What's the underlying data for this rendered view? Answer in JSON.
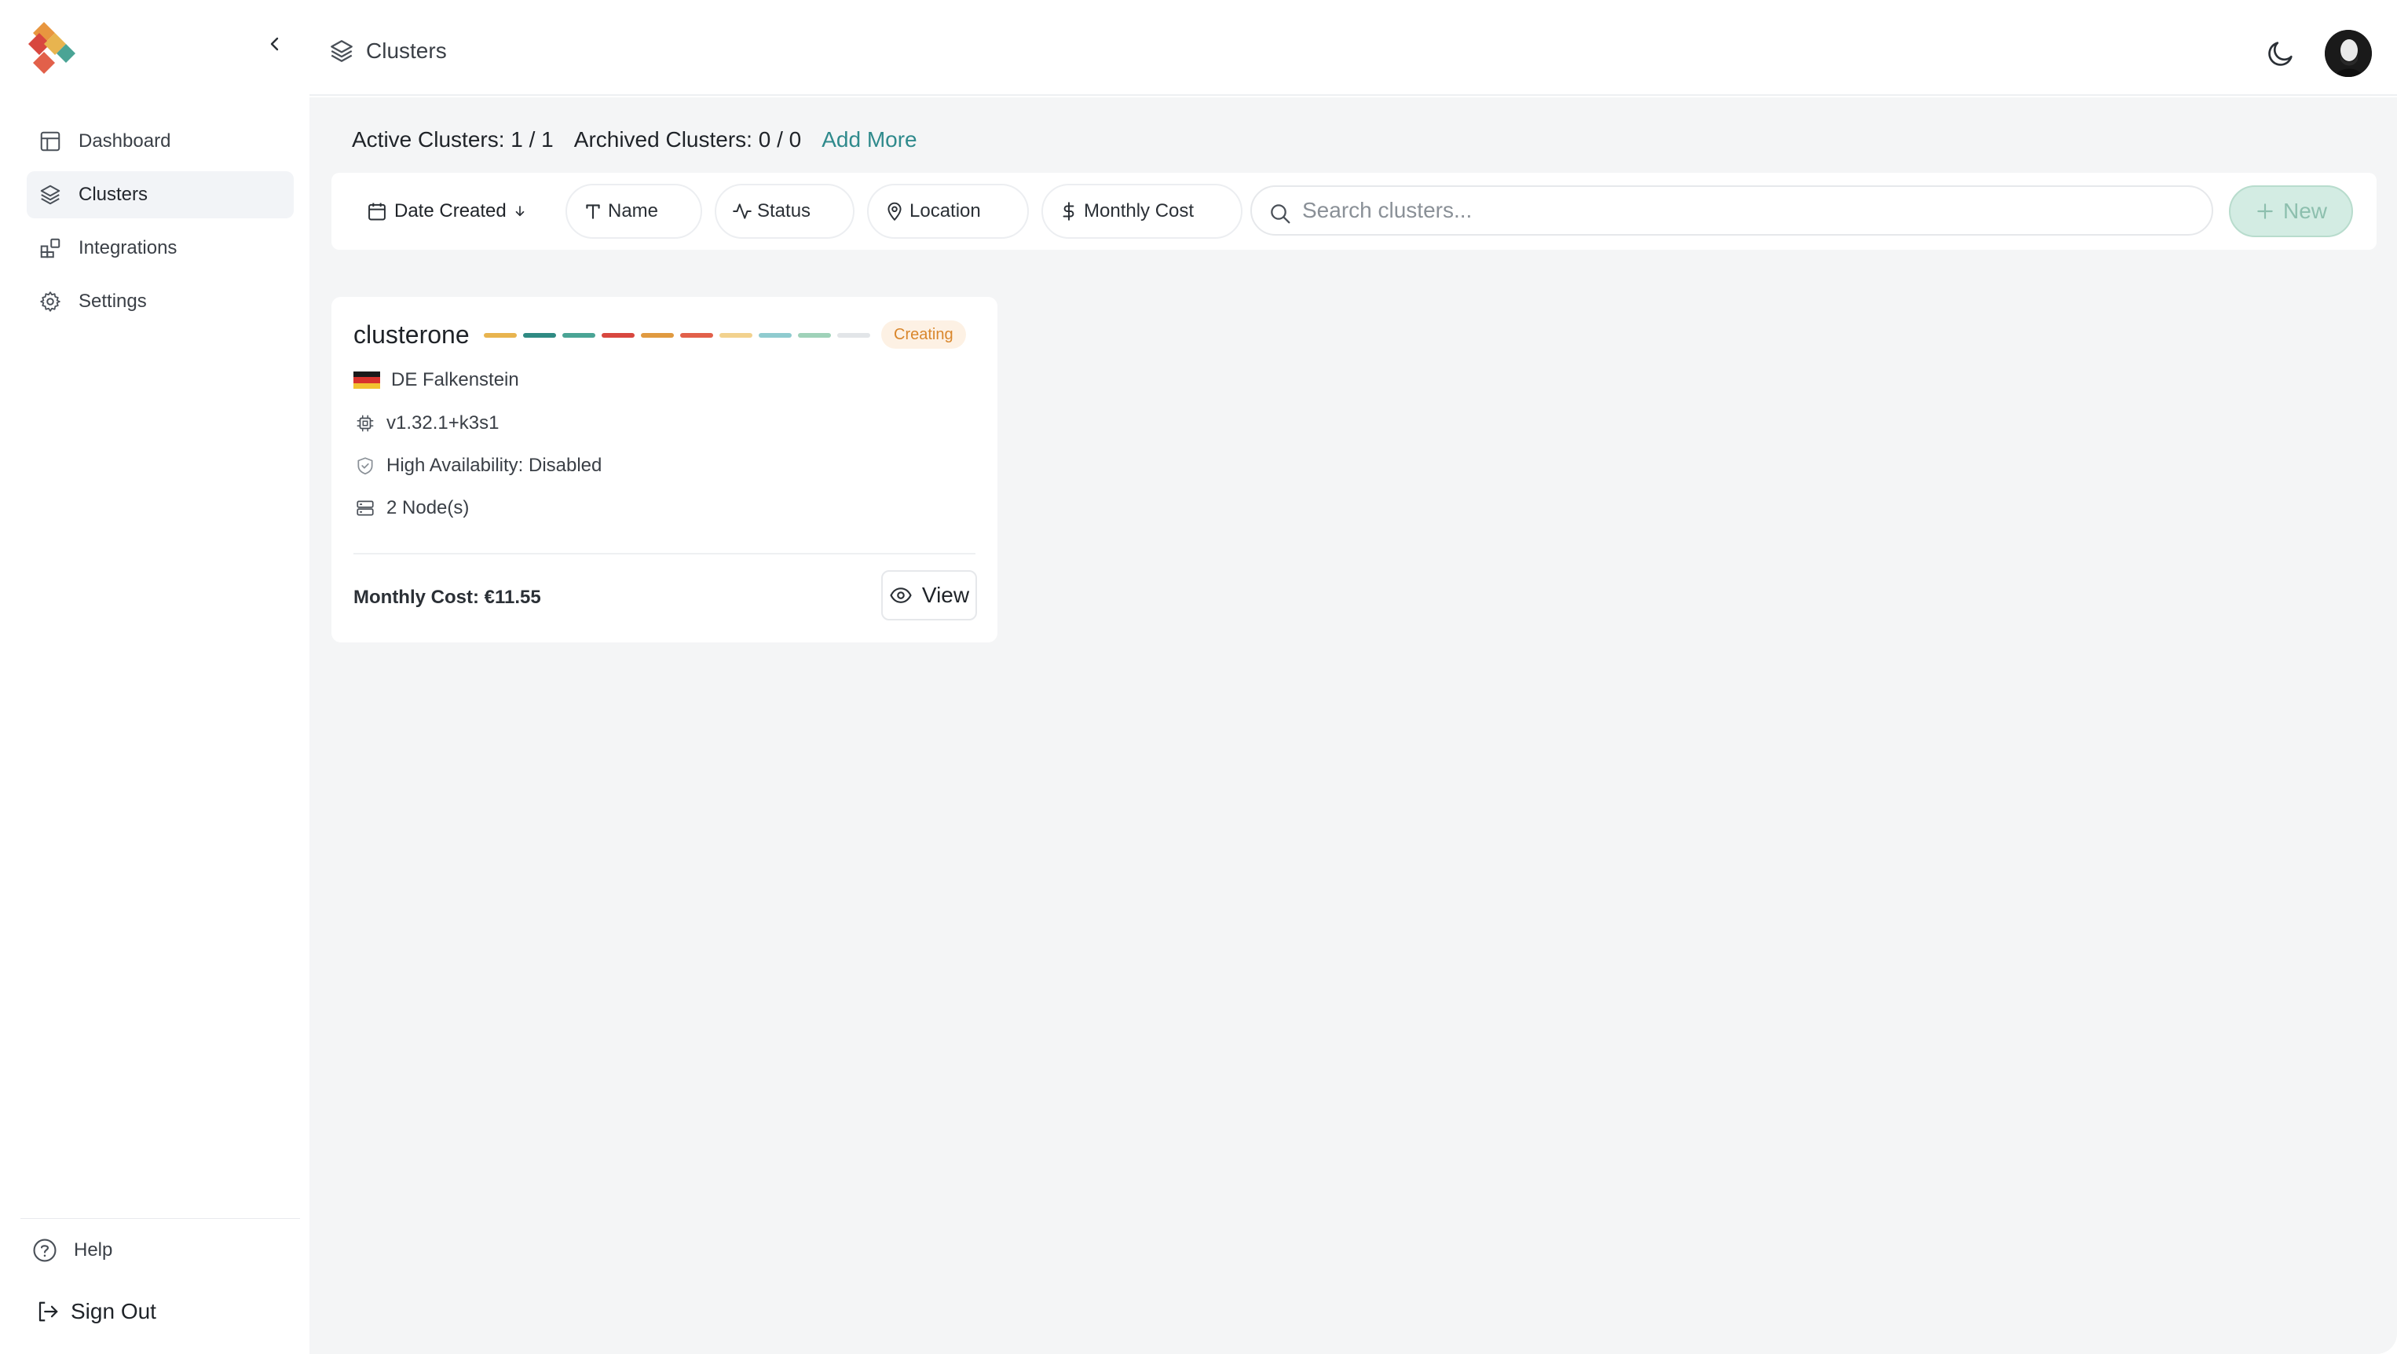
{
  "sidebar": {
    "items": [
      {
        "label": "Dashboard",
        "icon": "layout-icon"
      },
      {
        "label": "Clusters",
        "icon": "layers-icon",
        "active": true
      },
      {
        "label": "Integrations",
        "icon": "blocks-icon"
      },
      {
        "label": "Settings",
        "icon": "gear-icon"
      }
    ],
    "help_label": "Help",
    "signout_label": "Sign Out"
  },
  "header": {
    "breadcrumb": "Clusters"
  },
  "stats": {
    "active": "Active Clusters: 1 / 1",
    "archived": "Archived Clusters: 0 / 0",
    "add_more": "Add More"
  },
  "filters": {
    "sort_label": "Date Created",
    "chips": [
      "Name",
      "Status",
      "Location",
      "Monthly Cost"
    ],
    "search_placeholder": "Search clusters...",
    "new_label": "New"
  },
  "cluster": {
    "name": "clusterone",
    "status": "Creating",
    "segment_colors": [
      "#e8b44f",
      "#2f8a83",
      "#4aa495",
      "#d8473f",
      "#e09a40",
      "#e2604a",
      "#f2d28e",
      "#8fcbcf",
      "#9fd2b9",
      "#e2e5e8"
    ],
    "location": "DE Falkenstein",
    "version": "v1.32.1+k3s1",
    "ha": "High Availability: Disabled",
    "nodes": "2 Node(s)",
    "monthly_cost": "Monthly Cost: €11.55",
    "view_label": "View"
  },
  "colors": {
    "accent": "#2f8a8c",
    "status_creating": "#d9862b",
    "new_button_bg": "#d3ece3"
  }
}
